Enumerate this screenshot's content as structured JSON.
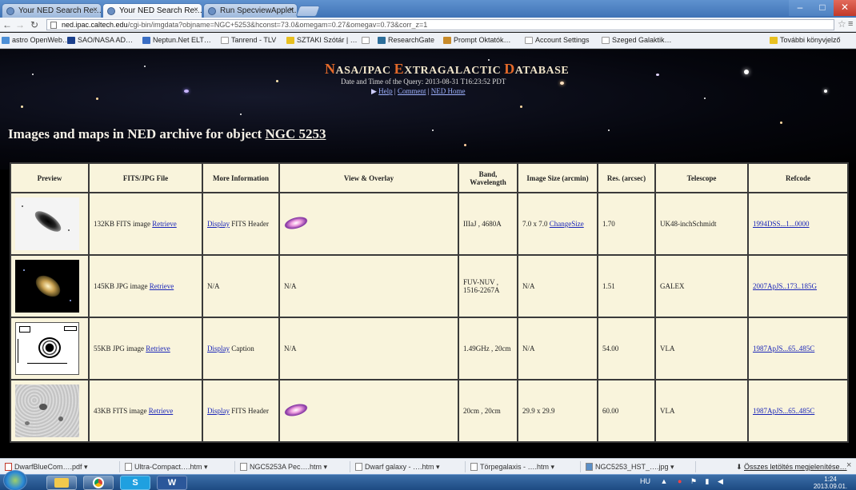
{
  "tabs": [
    {
      "label": "Your NED Search Re…",
      "active": false
    },
    {
      "label": "Your NED Search Re…",
      "active": true
    },
    {
      "label": "Run SpecviewApplet…",
      "active": false
    }
  ],
  "toolbar": {
    "back_icon": "back-arrow-icon",
    "forward_icon": "forward-arrow-icon",
    "reload_icon": "reload-icon",
    "url_host": "ned.ipac.caltech.edu",
    "url_path": "/cgi-bin/imgdata?objname=NGC+5253&hconst=73.0&omegam=0.27&omegav=0.73&corr_z=1"
  },
  "bookmarks": [
    {
      "label": "astro OpenWeb…",
      "color": "#4c8fd6"
    },
    {
      "label": "SAO/NASA AD…",
      "color": "#1a3f8c"
    },
    {
      "label": "Neptun.Net ELT…",
      "color": "#3a6ec4"
    },
    {
      "label": "Tanrend - TLV",
      "color": "#dddddd"
    },
    {
      "label": "SZTAKI Szótár | …",
      "color": "#e8c020"
    },
    {
      "label": "",
      "color": "#dddddd"
    },
    {
      "label": "ResearchGate",
      "color": "#2c6e9a"
    },
    {
      "label": "Prompt Oktatók…",
      "color": "#c88b2a"
    },
    {
      "label": "Account Settings",
      "color": "#dddddd"
    },
    {
      "label": "Szeged Galaktik…",
      "color": "#dddddd"
    },
    {
      "label": "További könyvjelző",
      "color": "#e8c020"
    }
  ],
  "banner": {
    "title_parts": [
      {
        "cap": "N",
        "rest": "ASA/IPAC "
      },
      {
        "cap": "E",
        "rest": "XTRAGALACTIC "
      },
      {
        "cap": "D",
        "rest": "ATABASE"
      }
    ],
    "subtitle": "Date and Time of the Query: 2013-08-31 T16:23:52 PDT",
    "link_help": "Help",
    "link_comment": "Comment",
    "link_home": "NED Home",
    "sep": " | "
  },
  "page_title": {
    "prefix": "Images and maps in NED archive for object ",
    "object": "NGC 5253"
  },
  "table": {
    "headers": [
      "Preview",
      "FITS/JPG File",
      "More Information",
      "View & Overlay",
      "Band, Wavelength",
      "Image Size (arcmin)",
      "Res. (arcsec)",
      "Telescope",
      "Refcode"
    ],
    "rows": [
      {
        "file_text": "132KB FITS image ",
        "file_link": "Retrieve",
        "info_link": "Display",
        "info_text": " FITS Header",
        "overlay": "icon",
        "band": "IIIaJ , 4680A",
        "size_text": "7.0 x 7.0 ",
        "size_link": "ChangeSize",
        "res": "1.70",
        "telescope": "UK48-inchSchmidt",
        "refcode": "1994DSS...1...0000"
      },
      {
        "file_text": "145KB JPG image ",
        "file_link": "Retrieve",
        "info_link": "",
        "info_text": "N/A",
        "overlay": "N/A",
        "band": "FUV-NUV , 1516-2267A",
        "size_text": "N/A",
        "size_link": "",
        "res": "1.51",
        "telescope": "GALEX",
        "refcode": "2007ApJS..173..185G"
      },
      {
        "file_text": "55KB JPG image ",
        "file_link": "Retrieve",
        "info_link": "Display",
        "info_text": " Caption",
        "overlay": "N/A",
        "band": "1.49GHz , 20cm",
        "size_text": "N/A",
        "size_link": "",
        "res": "54.00",
        "telescope": "VLA",
        "refcode": "1987ApJS...65..485C"
      },
      {
        "file_text": "43KB FITS image ",
        "file_link": "Retrieve",
        "info_link": "Display",
        "info_text": " FITS Header",
        "overlay": "icon",
        "band": "20cm , 20cm",
        "size_text": "29.9 x 29.9",
        "size_link": "",
        "res": "60.00",
        "telescope": "VLA",
        "refcode": "1987ApJS...65..485C"
      }
    ]
  },
  "downloads": [
    {
      "label": "DwarfBlueCom….pdf"
    },
    {
      "label": "Ultra-Compact….htm"
    },
    {
      "label": "NGC5253A Pec….htm"
    },
    {
      "label": "Dwarf galaxy - ….htm"
    },
    {
      "label": "Törpegalaxis - ….htm"
    },
    {
      "label": "NGC5253_HST_….jpg"
    }
  ],
  "downloads_all": "Összes letöltés megjelenítése…",
  "taskbar": {
    "apps": [
      "",
      "",
      "",
      "S",
      "W"
    ],
    "tray_lang": "HU",
    "time": "1:24",
    "date": "2013.09.01."
  }
}
